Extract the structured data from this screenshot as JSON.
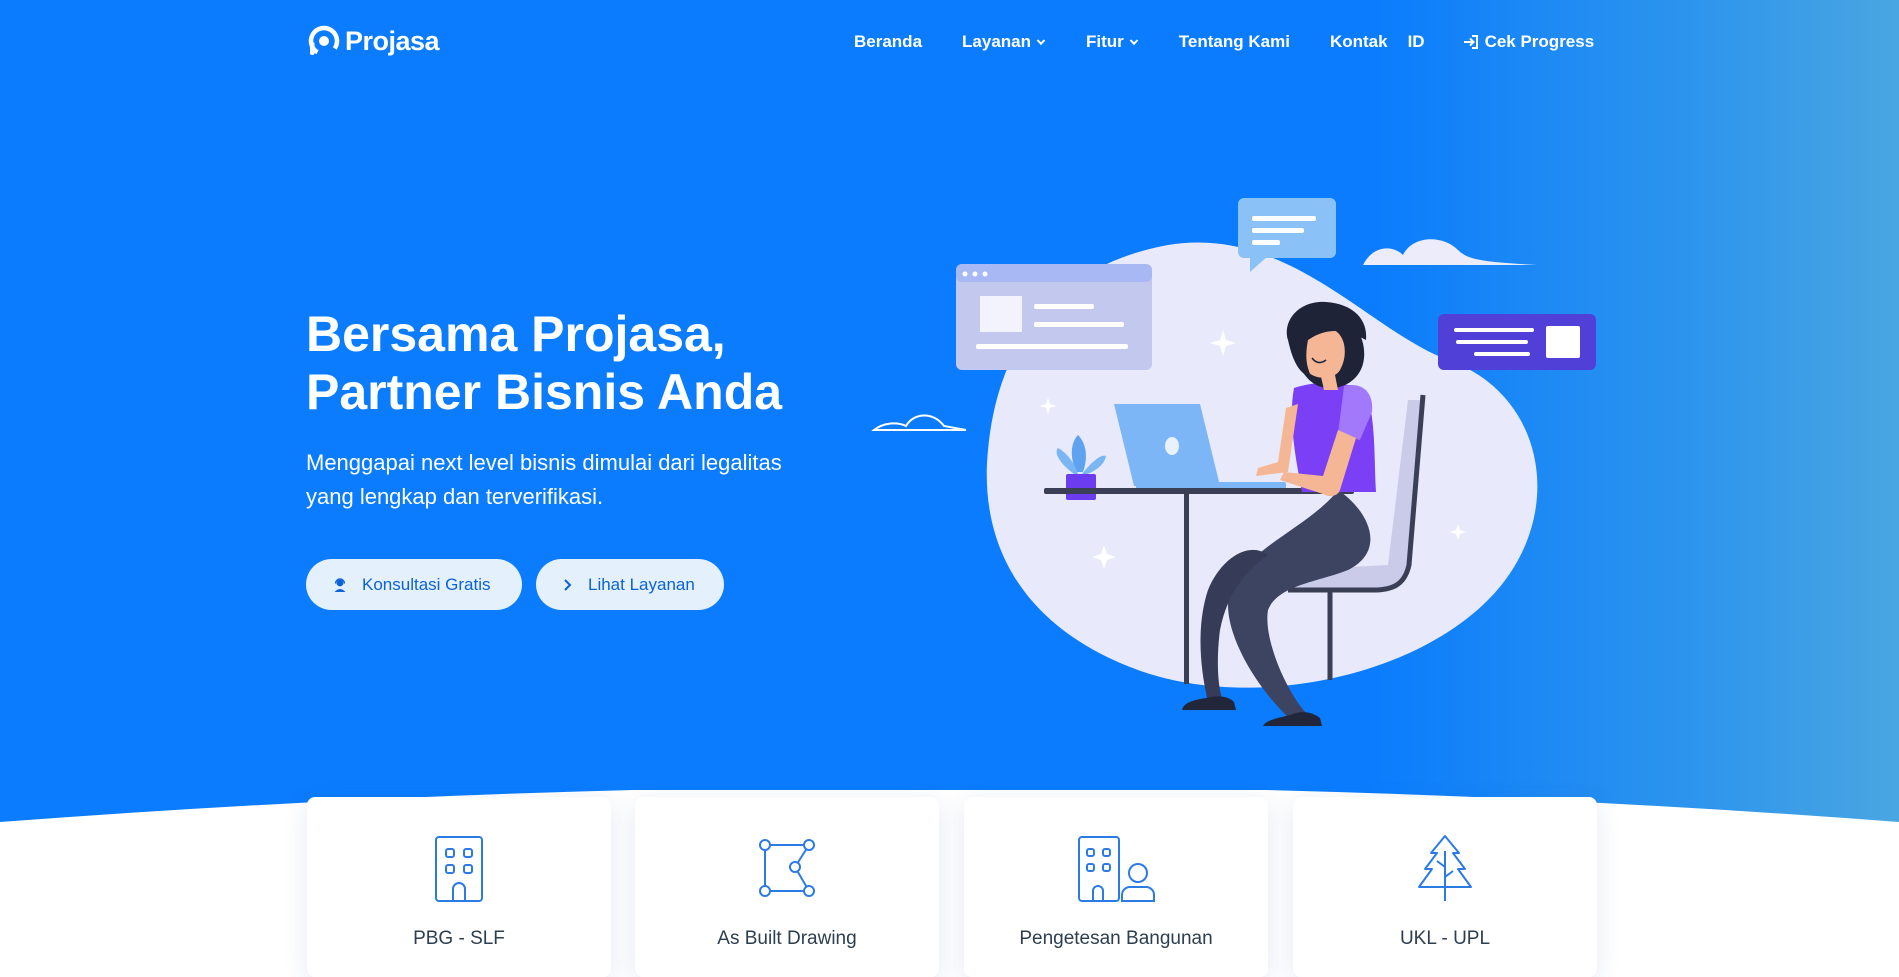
{
  "brand": {
    "name": "Projasa"
  },
  "nav": {
    "items": [
      {
        "label": "Beranda",
        "has_dropdown": false
      },
      {
        "label": "Layanan",
        "has_dropdown": true
      },
      {
        "label": "Fitur",
        "has_dropdown": true
      },
      {
        "label": "Tentang Kami",
        "has_dropdown": false
      },
      {
        "label": "Kontak",
        "has_dropdown": false
      }
    ],
    "language": "ID",
    "progress_label": "Cek Progress",
    "progress_icon": "sign-in-icon"
  },
  "hero": {
    "title_line1": "Bersama Projasa,",
    "title_line2": "Partner Bisnis Anda",
    "subtitle": "Menggapai next level bisnis dimulai dari legalitas yang lengkap dan terverifikasi.",
    "buttons": [
      {
        "label": "Konsultasi Gratis",
        "icon": "support-agent-icon"
      },
      {
        "label": "Lihat Layanan",
        "icon": "chevron-right-icon"
      }
    ]
  },
  "services": [
    {
      "title": "PBG - SLF",
      "icon": "building-icon"
    },
    {
      "title": "As Built Drawing",
      "icon": "polygon-nodes-icon"
    },
    {
      "title": "Pengetesan Bangunan",
      "icon": "building-user-icon"
    },
    {
      "title": "UKL - UPL",
      "icon": "tree-icon"
    }
  ],
  "colors": {
    "primary": "#0a7cfd",
    "button_bg": "#e4f0fb",
    "button_text": "#0a63d9",
    "card_text": "#2c3e50",
    "icon": "#2c7be5"
  }
}
